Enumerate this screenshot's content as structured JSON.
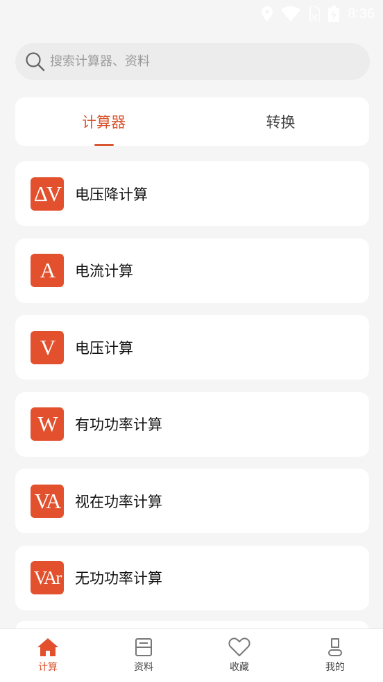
{
  "status_bar": {
    "time": "8:36"
  },
  "search": {
    "placeholder": "搜索计算器、资料",
    "value": ""
  },
  "tabs": [
    {
      "label": "计算器",
      "active": true
    },
    {
      "label": "转换",
      "active": false
    }
  ],
  "calculators": [
    {
      "symbol": "ΔV",
      "label": "电压降计算"
    },
    {
      "symbol": "A",
      "label": "电流计算"
    },
    {
      "symbol": "V",
      "label": "电压计算"
    },
    {
      "symbol": "W",
      "label": "有功功率计算"
    },
    {
      "symbol": "VA",
      "label": "视在功率计算"
    },
    {
      "symbol": "VAr",
      "label": "无功功率计算"
    }
  ],
  "bottom_nav": [
    {
      "label": "计算",
      "icon": "home-icon",
      "active": true
    },
    {
      "label": "资料",
      "icon": "document-icon",
      "active": false
    },
    {
      "label": "收藏",
      "icon": "heart-icon",
      "active": false
    },
    {
      "label": "我的",
      "icon": "user-icon",
      "active": false
    }
  ],
  "colors": {
    "accent": "#d9552f",
    "icon_bg": "#e2502d",
    "background": "#f5f5f5"
  }
}
